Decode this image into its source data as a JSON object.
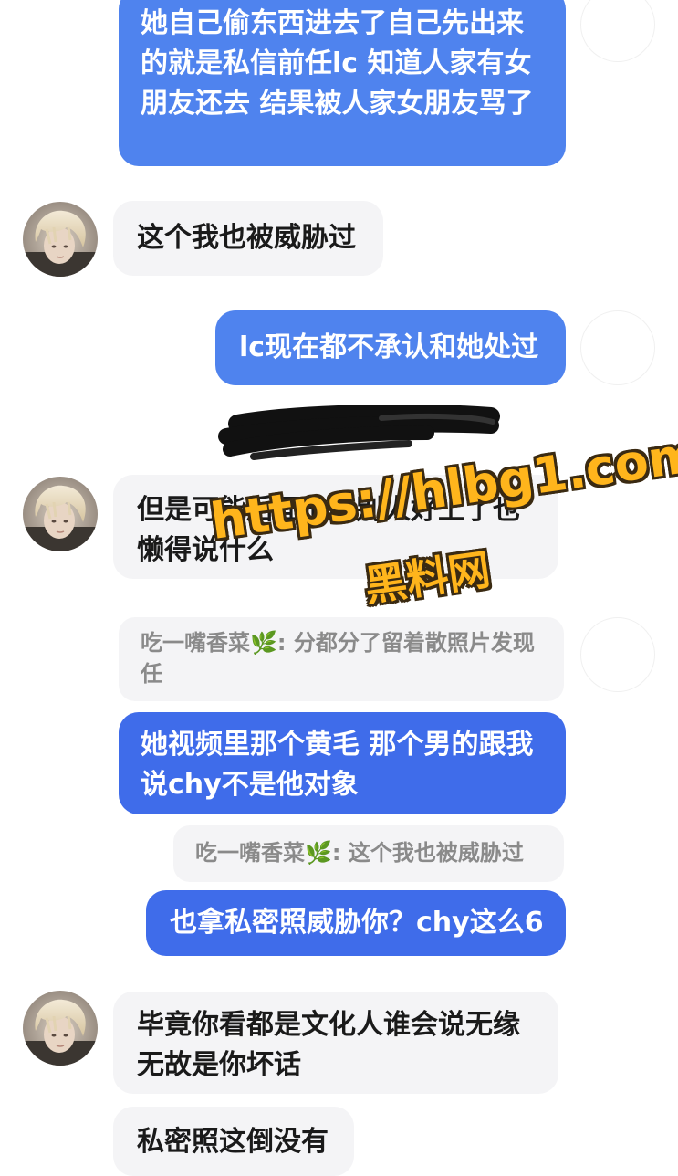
{
  "messages": {
    "m1": "她自己偷东西进去了自己先出来的就是私信前任lc 知道人家有女朋友还去 结果被人家女朋友骂了",
    "m2": "这个我也被威胁过",
    "m3": "lc现在都不承认和她处过",
    "m4": "但是可能后面他跟别人好上了也懒得说什么",
    "q1": "吃一嘴香菜🌿: 分都分了留着散照片发现任",
    "m5": "她视频里那个黄毛 那个男的跟我说chy不是他对象",
    "q2": "吃一嘴香菜🌿: 这个我也被威胁过",
    "m6": "也拿私密照威胁你？chy这么6",
    "m7": "毕竟你看都是文化人谁会说无缘无故是你坏话",
    "m8": "私密照这倒没有"
  },
  "watermark": {
    "url": "https://hlbg1.com",
    "name": "黑料网"
  },
  "colors": {
    "outgoing": "#4f83ee",
    "outgoing_deep": "#3f6cea",
    "incoming": "#f4f4f6",
    "watermark": "#ffb51c"
  },
  "icons": {
    "avatar": "contact-avatar-blonde",
    "redaction": "black-marker-scribble"
  }
}
